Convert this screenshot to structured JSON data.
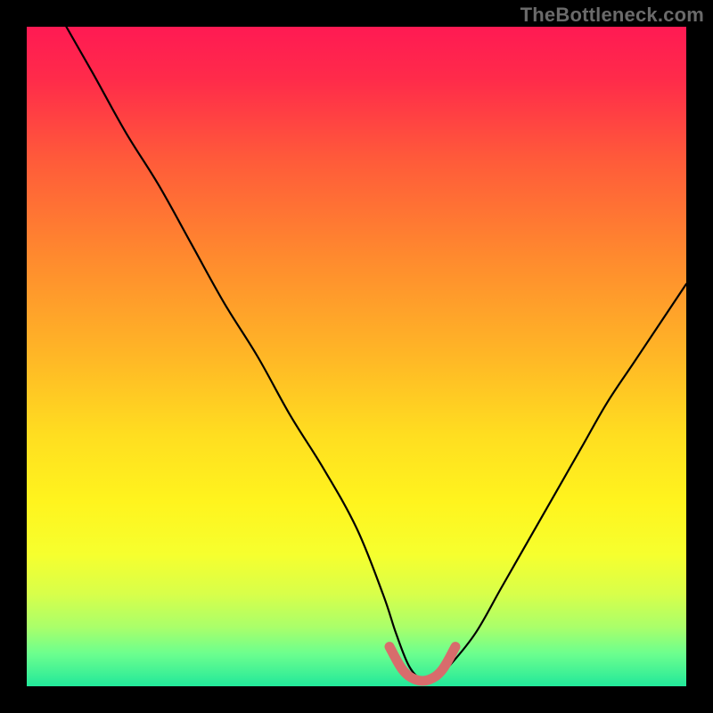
{
  "watermark": "TheBottleneck.com",
  "colors": {
    "frame": "#000000",
    "curve": "#000000",
    "highlight": "#d86c6c"
  },
  "gradient_stops": [
    {
      "offset": 0.0,
      "color": "#ff1a53"
    },
    {
      "offset": 0.08,
      "color": "#ff2b4a"
    },
    {
      "offset": 0.2,
      "color": "#ff5a3a"
    },
    {
      "offset": 0.35,
      "color": "#ff8a2e"
    },
    {
      "offset": 0.5,
      "color": "#ffb726"
    },
    {
      "offset": 0.62,
      "color": "#ffde20"
    },
    {
      "offset": 0.72,
      "color": "#fff41e"
    },
    {
      "offset": 0.8,
      "color": "#f6ff2e"
    },
    {
      "offset": 0.86,
      "color": "#d8ff4a"
    },
    {
      "offset": 0.91,
      "color": "#aaff6a"
    },
    {
      "offset": 0.95,
      "color": "#6dff8e"
    },
    {
      "offset": 1.0,
      "color": "#22e89a"
    }
  ],
  "chart_data": {
    "type": "line",
    "title": "",
    "xlabel": "",
    "ylabel": "",
    "xlim": [
      0,
      100
    ],
    "ylim": [
      0,
      100
    ],
    "series": [
      {
        "name": "bottleneck-curve",
        "x": [
          6,
          10,
          15,
          20,
          25,
          30,
          35,
          40,
          45,
          50,
          54,
          56,
          58,
          60,
          62,
          64,
          68,
          72,
          76,
          80,
          84,
          88,
          92,
          96,
          100
        ],
        "y": [
          100,
          93,
          84,
          76,
          67,
          58,
          50,
          41,
          33,
          24,
          14,
          8,
          3,
          1,
          1,
          3,
          8,
          15,
          22,
          29,
          36,
          43,
          49,
          55,
          61
        ]
      },
      {
        "name": "bottom-highlight",
        "x": [
          55,
          57,
          59,
          61,
          63,
          65
        ],
        "y": [
          6,
          2.5,
          1,
          1,
          2.5,
          6
        ]
      }
    ]
  }
}
